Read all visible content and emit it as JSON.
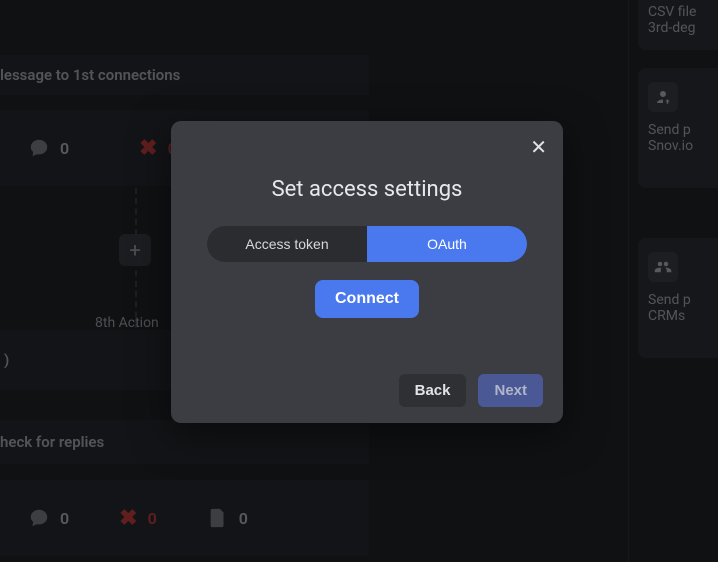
{
  "background": {
    "row1_label": "lessage to 1st connections",
    "row_metrics_zero": "0",
    "add_button": "+",
    "action_label": "8th Action",
    "single_zero": ")",
    "row4_label": "heck for replies",
    "right": {
      "card1_line1": "CSV file",
      "card1_line2": "3rd-deg",
      "card2_line1": "Send p",
      "card2_line2": "Snov.io",
      "card3_line1": "Send p",
      "card3_line2": "CRMs"
    }
  },
  "icons": {
    "chat": "chat",
    "x": "✕",
    "clipboard": "≣",
    "person_arrow": "↪",
    "people": "👥"
  },
  "modal": {
    "title": "Set access settings",
    "tab_access_token": "Access token",
    "tab_oauth": "OAuth",
    "connect": "Connect",
    "back": "Back",
    "next": "Next",
    "close": "✕"
  }
}
